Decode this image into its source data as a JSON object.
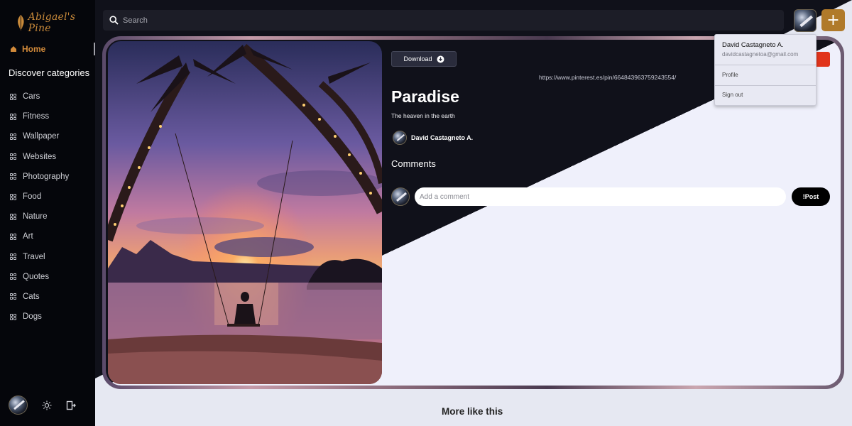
{
  "app": {
    "logo_text": "Abigael's Pine"
  },
  "sidebar": {
    "home_label": "Home",
    "categories_title": "Discover categories",
    "categories": [
      "Cars",
      "Fitness",
      "Wallpaper",
      "Websites",
      "Photography",
      "Food",
      "Nature",
      "Art",
      "Travel",
      "Quotes",
      "Cats",
      "Dogs"
    ]
  },
  "header": {
    "search_placeholder": "Search",
    "add_label": "+"
  },
  "pin": {
    "download_label": "Download",
    "url": "https://www.pinterest.es/pin/664843963759243554/",
    "title": "Paradise",
    "description": "The heaven in the earth",
    "author": "David Castagneto A."
  },
  "comments": {
    "title": "Comments",
    "input_placeholder": "Add a comment",
    "post_label": "!Post"
  },
  "dropdown": {
    "name": "David Castagneto A.",
    "email": "davidcastagnetoa@gmail.com",
    "profile_label": "Profile",
    "signout_label": "Sign out"
  },
  "more": {
    "title": "More like this"
  },
  "colors": {
    "accent": "#b07a2a",
    "save": "#e1341b",
    "sidebar_bg": "#05060b"
  }
}
